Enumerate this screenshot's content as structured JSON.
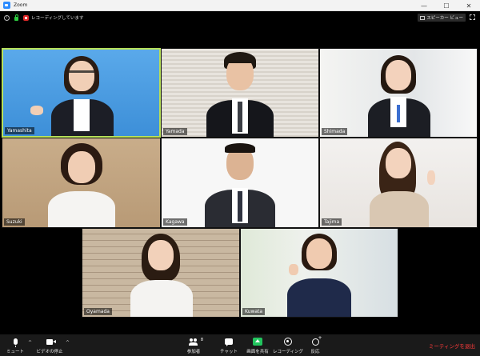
{
  "window": {
    "title": "Zoom",
    "controls": [
      "—",
      "☐",
      "✕"
    ]
  },
  "topbar": {
    "recording_text": "レコーディングしています",
    "speaker_view_label": "スピーカー ビュー"
  },
  "tiles": [
    {
      "name": "Yamashita",
      "active": true
    },
    {
      "name": "Yamada",
      "active": false
    },
    {
      "name": "Shimada",
      "active": false
    },
    {
      "name": "Suzuki",
      "active": false
    },
    {
      "name": "Kagawa",
      "active": false
    },
    {
      "name": "Tajima",
      "active": false
    },
    {
      "name": "Oyamada",
      "active": false
    },
    {
      "name": "Kuwata",
      "active": false
    }
  ],
  "toolbar": {
    "mute_label": "ミュート",
    "video_label": "ビデオの停止",
    "participants_label": "参加者",
    "participants_count": "8",
    "chat_label": "チャット",
    "share_label": "画面を共有",
    "record_label": "レコーディング",
    "reactions_label": "反応",
    "leave_label": "ミーティングを退出",
    "caret": "^"
  },
  "colors": {
    "active_speaker": "#b8e05a",
    "share_green": "#22c55e",
    "leave_red": "#ff3b3b",
    "lock_green": "#2ecc40",
    "record_red": "#e02828"
  }
}
